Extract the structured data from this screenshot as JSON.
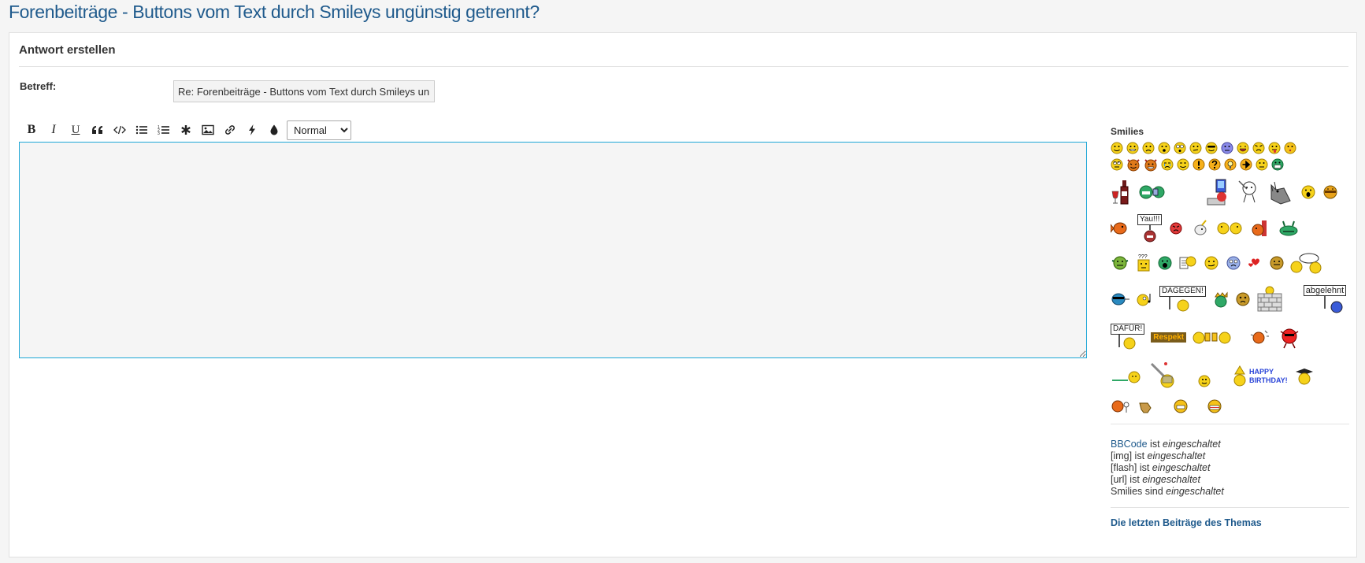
{
  "page": {
    "title": "Forenbeiträge - Buttons vom Text durch Smileys ungünstig getrennt?"
  },
  "panel": {
    "title": "Antwort erstellen"
  },
  "subject": {
    "label": "Betreff:",
    "value": "Re: Forenbeiträge - Buttons vom Text durch Smileys un"
  },
  "toolbar": {
    "bold": "B",
    "italic": "I",
    "underline": "U",
    "quote": "❝",
    "code": "</>",
    "font_size_selected": "Normal",
    "font_size_options": [
      "Normal"
    ]
  },
  "editor": {
    "value": ""
  },
  "smilies": {
    "title": "Smilies",
    "signs": {
      "yau": "Yau!!!",
      "dagegen": "DAGEGEN!",
      "abgelehnt": "abgelehnt",
      "dafuer": "DAFÜR!",
      "respekt": "Respekt",
      "hb1": "HAPPY",
      "hb2": "BIRTHDAY!"
    }
  },
  "status": {
    "bbcode_link": "BBCode",
    "bbcode_rest": " ist ",
    "img": "[img] ist ",
    "flash": "[flash] ist ",
    "url": "[url] ist ",
    "smilies": "Smilies sind ",
    "enabled": "eingeschaltet"
  },
  "last_posts": "Die letzten Beiträge des Themas",
  "colors": {
    "title": "#1f5a8c",
    "editor_border": "#1ea7d6",
    "smiley_yellow": "#f6d21a"
  }
}
